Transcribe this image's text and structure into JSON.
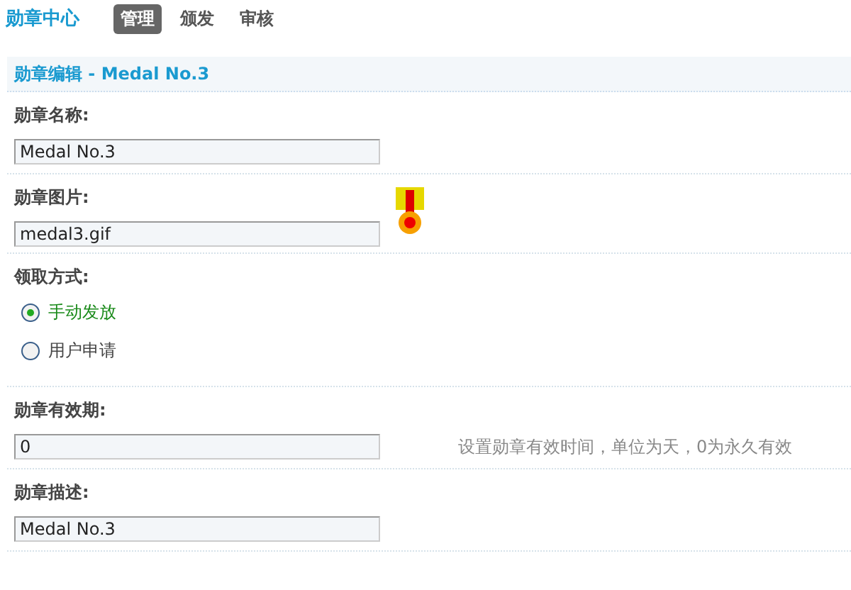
{
  "header": {
    "title": "勋章中心",
    "tabs": [
      {
        "label": "管理",
        "selected": true
      },
      {
        "label": "颁发",
        "selected": false
      },
      {
        "label": "审核",
        "selected": false
      }
    ]
  },
  "panel": {
    "title": "勋章编辑 - Medal No.3"
  },
  "fields": [
    {
      "kind": "text",
      "label": "勋章名称:",
      "value": "Medal No.3"
    },
    {
      "kind": "image",
      "label": "勋章图片:",
      "value": "medal3.gif"
    },
    {
      "kind": "radio",
      "label": "领取方式:",
      "options": [
        {
          "label": "手动发放",
          "selected": true
        },
        {
          "label": "用户申请",
          "selected": false
        }
      ]
    },
    {
      "kind": "text",
      "label": "勋章有效期:",
      "value": "0",
      "hint": "设置勋章有效时间，单位为天，0为永久有效"
    },
    {
      "kind": "text",
      "label": "勋章描述:",
      "value": "Medal No.3"
    }
  ]
}
